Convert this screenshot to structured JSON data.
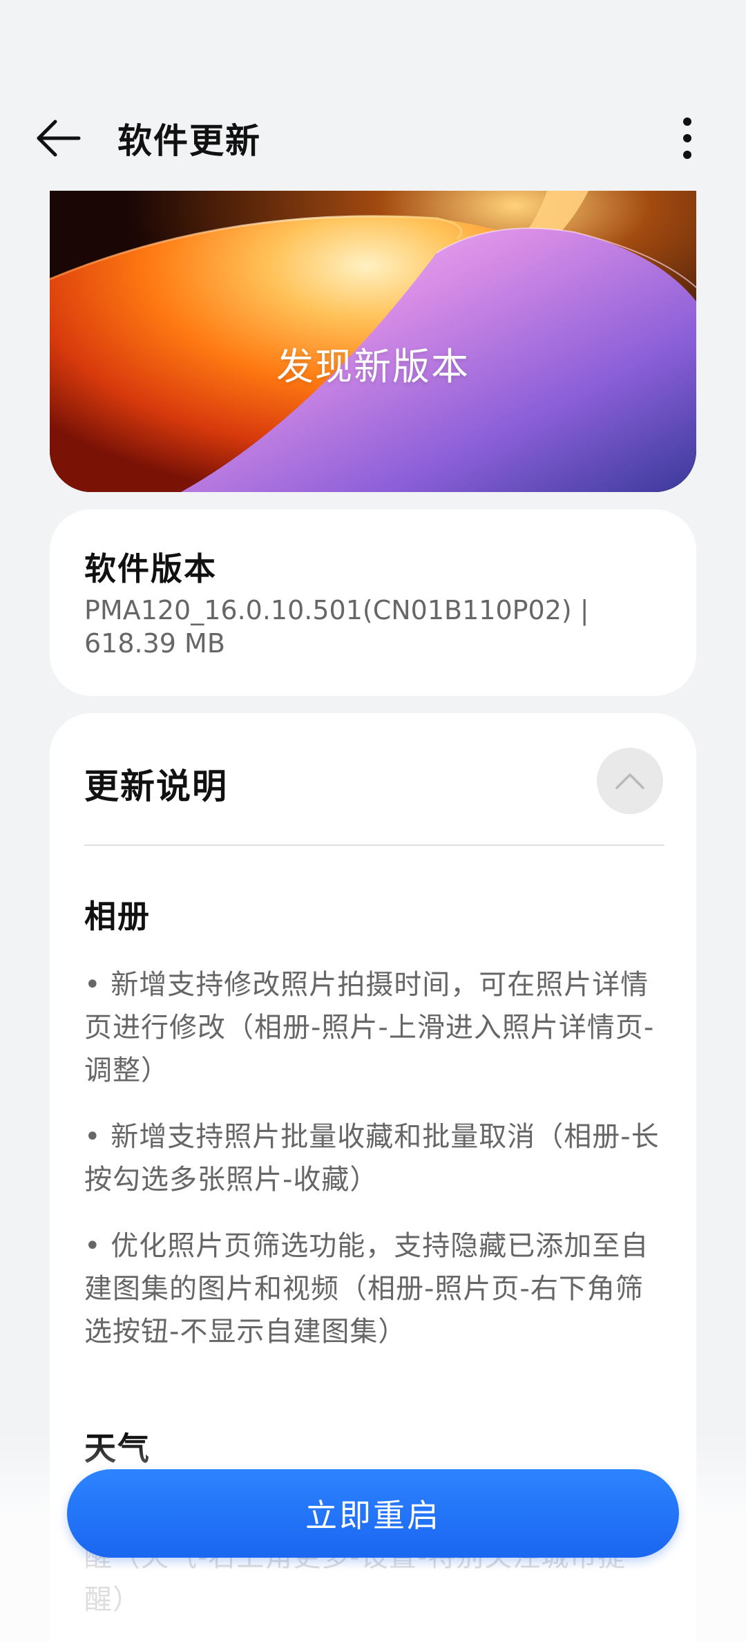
{
  "header": {
    "title": "软件更新",
    "back_icon": "arrow-left-icon",
    "more_icon": "more-vertical-icon"
  },
  "banner": {
    "title": "发现新版本"
  },
  "version": {
    "label": "软件版本",
    "value": "PMA120_16.0.10.501(CN01B110P02) | 618.39 MB"
  },
  "notes": {
    "title": "更新说明",
    "collapse_icon": "chevron-up-icon",
    "sections": [
      {
        "title": "相册",
        "items": [
          "• 新增支持修改照片拍摄时间，可在照片详情页进行修改（相册-照片-上滑进入照片详情页-调整）",
          "• 新增支持照片批量收藏和批量取消（相册-长按勾选多张照片-收藏）",
          "• 优化照片页筛选功能，支持隐藏已添加至自建图集的图片和视频（相册-照片页-右下角筛选按钮-不显示自建图集）"
        ]
      },
      {
        "title": "天气",
        "items": [
          "心的城市，当地出现极端天气，将自动推送提醒（天气-右上角更多-设置-特别关注城市提醒）"
        ]
      }
    ]
  },
  "action": {
    "restart_label": "立即重启"
  },
  "colors": {
    "background": "#f1f3f5",
    "primary_button": "#1a66f0",
    "card": "#ffffff",
    "secondary_text": "#666666"
  }
}
